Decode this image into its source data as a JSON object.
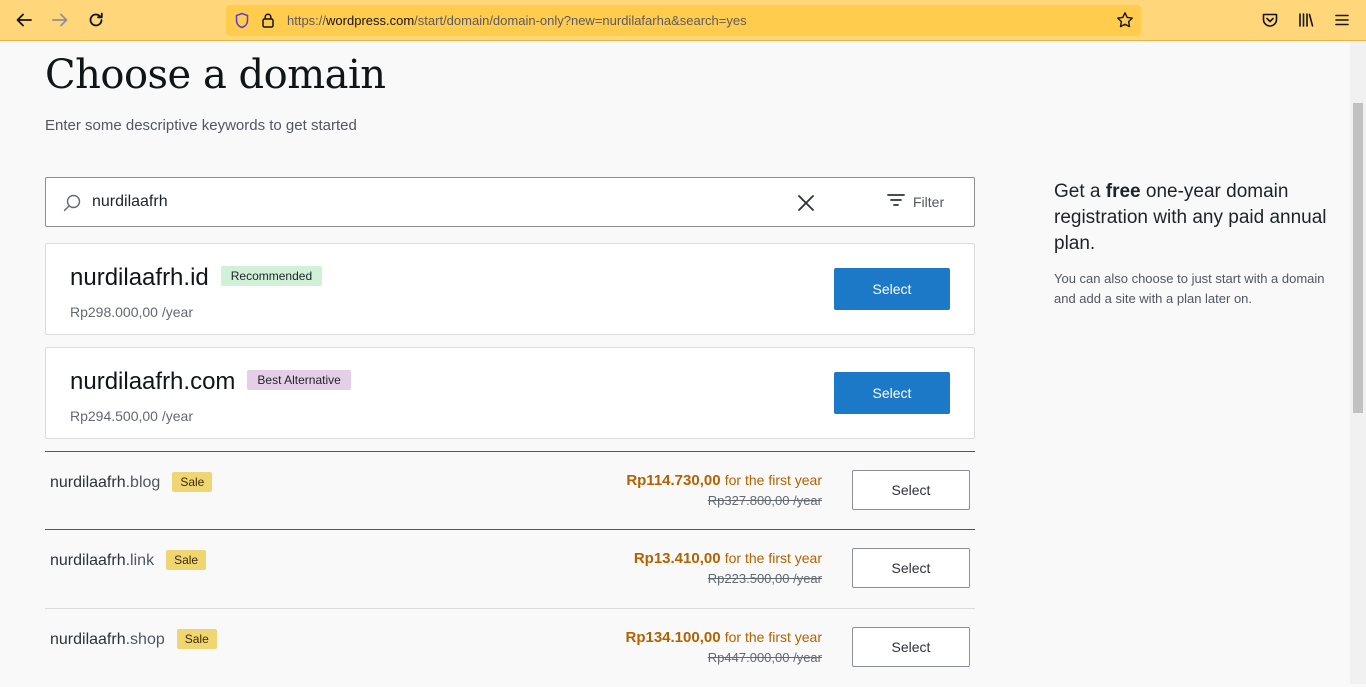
{
  "browser": {
    "url_prefix": "https://",
    "url_host": "wordpress.com",
    "url_path": "/start/domain/domain-only?new=nurdilafarha&search=yes"
  },
  "page": {
    "title": "Choose a domain",
    "subtitle": "Enter some descriptive keywords to get started"
  },
  "search": {
    "value": "nurdilaafrh",
    "filter_label": "Filter"
  },
  "featured": [
    {
      "name": "nurdilaafrh.id",
      "badge": "Recommended",
      "price": "Rp298.000,00 /year",
      "button": "Select"
    },
    {
      "name": "nurdilaafrh.com",
      "badge": "Best Alternative",
      "price": "Rp294.500,00 /year",
      "button": "Select"
    }
  ],
  "results": [
    {
      "base": "nurdilaafrh",
      "tld": ".blog",
      "badge": "Sale",
      "sale_price": "Rp114.730,00",
      "sale_suffix": "for the first year",
      "original_price": "Rp327.800,00 /year",
      "button": "Select"
    },
    {
      "base": "nurdilaafrh",
      "tld": ".link",
      "badge": "Sale",
      "sale_price": "Rp13.410,00",
      "sale_suffix": "for the first year",
      "original_price": "Rp223.500,00 /year",
      "button": "Select"
    },
    {
      "base": "nurdilaafrh",
      "tld": ".shop",
      "badge": "Sale",
      "sale_price": "Rp134.100,00",
      "sale_suffix": "for the first year",
      "original_price": "Rp447.000,00 /year",
      "button": "Select"
    }
  ],
  "promo": {
    "title_before": "Get a ",
    "title_bold": "free",
    "title_after": " one-year domain registration with any paid annual plan.",
    "text": "You can also choose to just start with a domain and add a site with a plan later on."
  },
  "colors": {
    "toolbar": "#ffd67a",
    "urlbar": "#ffcc4d",
    "primary_button": "#1b79c8",
    "sale_price": "#b26200",
    "recommended_badge": "#d0f0d8",
    "alternative_badge": "#e5cfe8",
    "sale_badge": "#f0d673"
  }
}
